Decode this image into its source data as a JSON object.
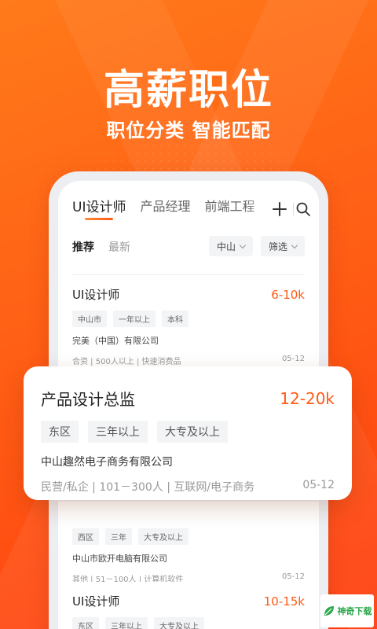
{
  "hero": {
    "title": "高薪职位",
    "subtitle": "职位分类 智能匹配"
  },
  "tabs": [
    {
      "label": "UI设计师",
      "active": true
    },
    {
      "label": "产品经理",
      "active": false
    },
    {
      "label": "前端工程",
      "active": false
    }
  ],
  "icons": {
    "add": "plus-icon",
    "search": "search-icon"
  },
  "filters": {
    "recommend": "推荐",
    "latest": "最新",
    "city": "中山",
    "screen": "筛选"
  },
  "jobs": [
    {
      "title": "UI设计师",
      "salary": "6-10k",
      "tags": [
        "中山市",
        "一年以上",
        "本科"
      ],
      "company": "完美（中国）有限公司",
      "info": "合资 | 500人以上 | 快速消费品",
      "date": "05-12"
    },
    {
      "title": "产品设计总监",
      "salary": "12-20k",
      "tags": [
        "东区",
        "三年以上",
        "大专及以上"
      ],
      "company": "中山趣然电子商务有限公司",
      "info": "民营/私企 | 101－300人 | 互联网/电子商务",
      "date": "05-12"
    },
    {
      "title": "",
      "salary": "",
      "tags": [
        "西区",
        "三年",
        "大专及以上"
      ],
      "company": "中山市欧开电脑有限公司",
      "info": "其他 | 51－100人 | 计算机软件",
      "date": "05-12"
    },
    {
      "title": "UI设计师",
      "salary": "10-15k",
      "tags": [
        "东区",
        "三年以上",
        "大专及以上"
      ],
      "company": "",
      "info": "",
      "date": ""
    }
  ],
  "watermark": {
    "text": "神奇下载"
  },
  "colors": {
    "accent": "#ff5a14",
    "brand_gradient_start": "#ff7a1a",
    "watermark": "#2aa84a"
  }
}
